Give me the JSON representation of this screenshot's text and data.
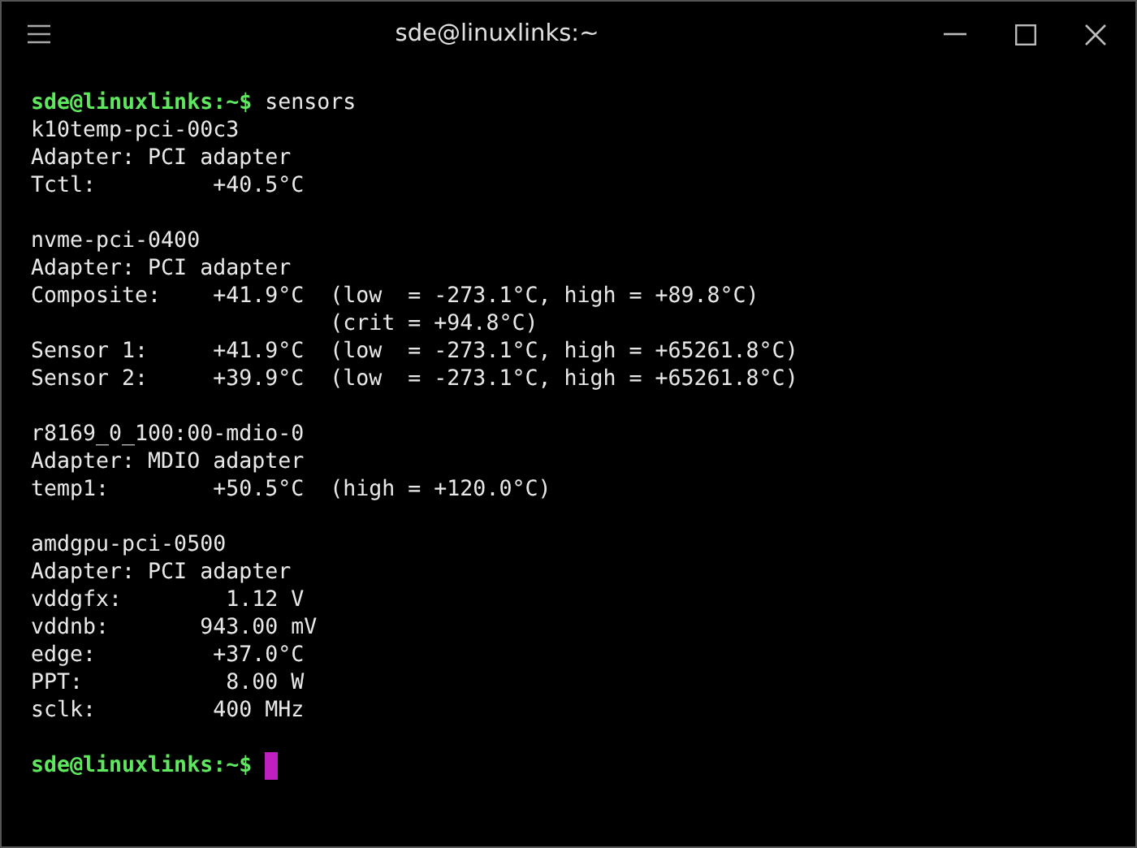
{
  "window": {
    "title": "sde@linuxlinks:~"
  },
  "terminal": {
    "lines": [
      {
        "kind": "prompt",
        "prompt": "sde@linuxlinks:~$",
        "command": "sensors"
      },
      {
        "kind": "output",
        "text": "k10temp-pci-00c3"
      },
      {
        "kind": "output",
        "text": "Adapter: PCI adapter"
      },
      {
        "kind": "output",
        "text": "Tctl:         +40.5°C"
      },
      {
        "kind": "blank"
      },
      {
        "kind": "output",
        "text": "nvme-pci-0400"
      },
      {
        "kind": "output",
        "text": "Adapter: PCI adapter"
      },
      {
        "kind": "output",
        "text": "Composite:    +41.9°C  (low  = -273.1°C, high = +89.8°C)"
      },
      {
        "kind": "output",
        "text": "                       (crit = +94.8°C)"
      },
      {
        "kind": "output",
        "text": "Sensor 1:     +41.9°C  (low  = -273.1°C, high = +65261.8°C)"
      },
      {
        "kind": "output",
        "text": "Sensor 2:     +39.9°C  (low  = -273.1°C, high = +65261.8°C)"
      },
      {
        "kind": "blank"
      },
      {
        "kind": "output",
        "text": "r8169_0_100:00-mdio-0"
      },
      {
        "kind": "output",
        "text": "Adapter: MDIO adapter"
      },
      {
        "kind": "output",
        "text": "temp1:        +50.5°C  (high = +120.0°C)"
      },
      {
        "kind": "blank"
      },
      {
        "kind": "output",
        "text": "amdgpu-pci-0500"
      },
      {
        "kind": "output",
        "text": "Adapter: PCI adapter"
      },
      {
        "kind": "output",
        "text": "vddgfx:        1.12 V"
      },
      {
        "kind": "output",
        "text": "vddnb:       943.00 mV"
      },
      {
        "kind": "output",
        "text": "edge:         +37.0°C"
      },
      {
        "kind": "output",
        "text": "PPT:           8.00 W"
      },
      {
        "kind": "output",
        "text": "sclk:         400 MHz"
      },
      {
        "kind": "blank"
      },
      {
        "kind": "prompt",
        "prompt": "sde@linuxlinks:~$",
        "cursor": true
      }
    ]
  }
}
